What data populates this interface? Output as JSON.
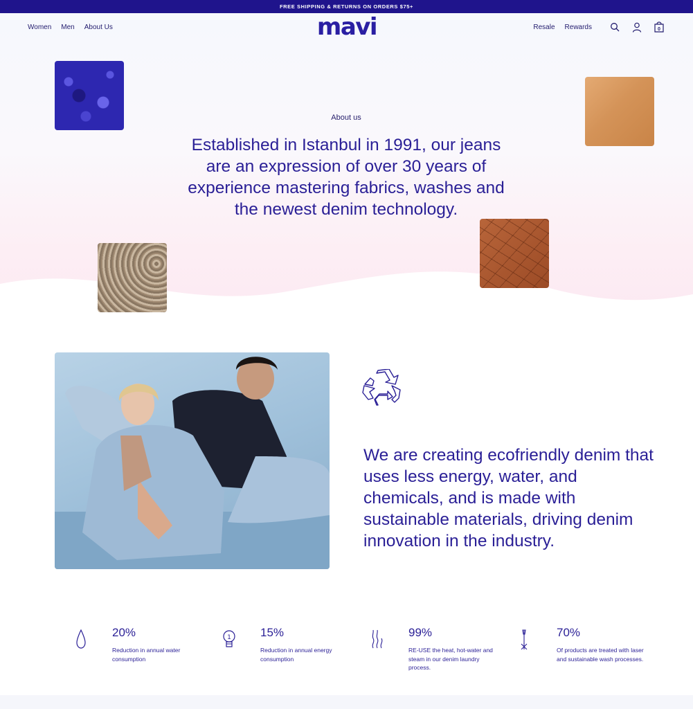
{
  "promo": {
    "text": "FREE SHIPPING & RETURNS ON ORDERS $75+"
  },
  "nav": {
    "left_links": [
      "Women",
      "Men",
      "About Us"
    ],
    "logo": "mavi",
    "right_links": [
      "Resale",
      "Rewards"
    ],
    "icons": [
      "search-icon",
      "account-icon",
      "cart-icon"
    ],
    "cart_count": "0"
  },
  "hero": {
    "label": "About us",
    "headline": "Established in Istanbul in 1991, our jeans are an expression of over 30 years of experience mastering fabrics, washes and the newest denim technology."
  },
  "eco": {
    "icon": "recycle-icon",
    "text": "We are creating ecofriendly denim that uses less energy, water, and chemicals, and is made with sustainable materials, driving denim innovation in the industry."
  },
  "stats": [
    {
      "icon": "water-drop-icon",
      "value": "20%",
      "desc": "Reduction in annual water consumption"
    },
    {
      "icon": "lightbulb-icon",
      "value": "15%",
      "desc": "Reduction in annual energy consumption"
    },
    {
      "icon": "steam-icon",
      "value": "99%",
      "desc": "RE-USE the heat, hot-water and steam in our denim laundry process."
    },
    {
      "icon": "laser-icon",
      "value": "70%",
      "desc": "Of products are treated with laser and sustainable wash processes."
    }
  ],
  "colors": {
    "brand": "#2a1fa3",
    "promo_bg": "#1f148c",
    "text": "#2a1f96"
  }
}
